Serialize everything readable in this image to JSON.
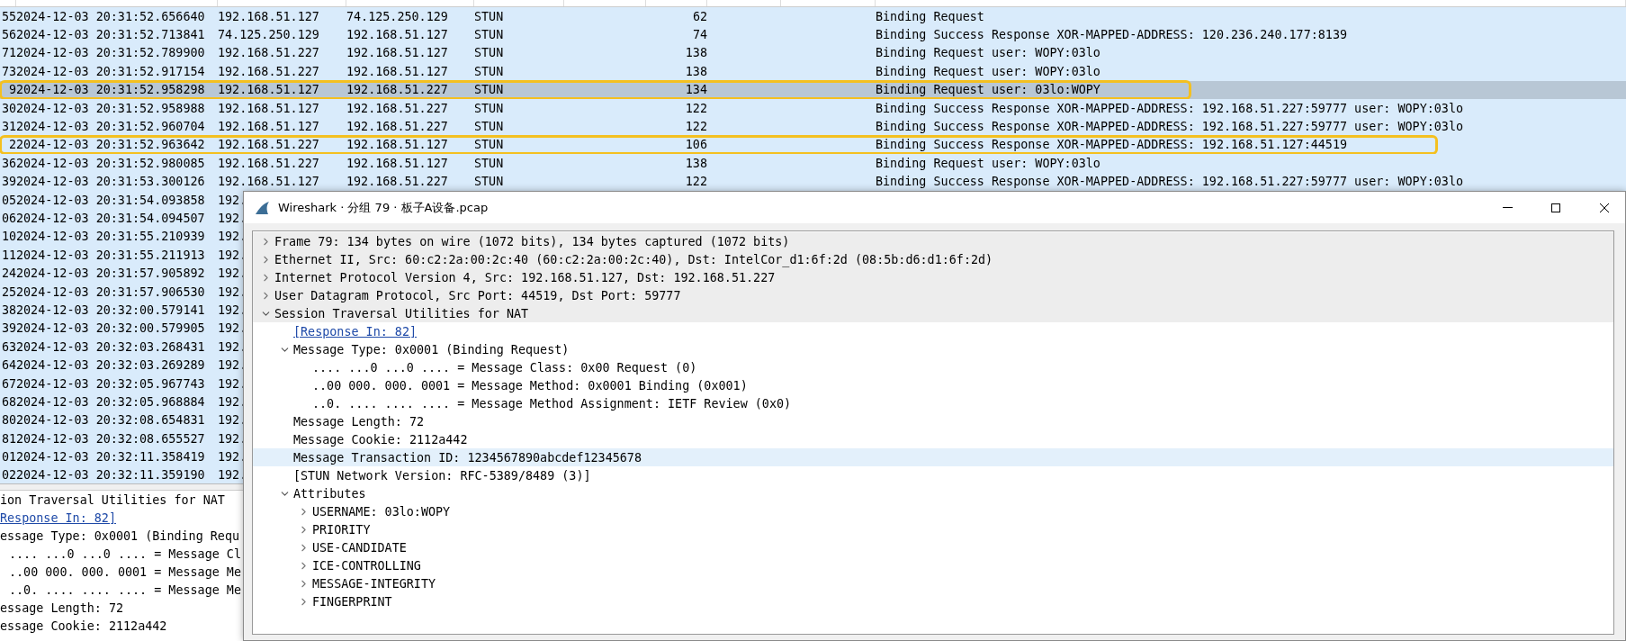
{
  "packet_list": {
    "rows": [
      {
        "no": "55",
        "time": "2024-12-03 20:31:52.656640",
        "source": "192.168.51.127",
        "destination": "74.125.250.129",
        "protocol": "STUN",
        "length": "62",
        "info": "Binding Request",
        "selected": false,
        "annotated": false
      },
      {
        "no": "56",
        "time": "2024-12-03 20:31:52.713841",
        "source": "74.125.250.129",
        "destination": "192.168.51.127",
        "protocol": "STUN",
        "length": "74",
        "info": "Binding Success Response XOR-MAPPED-ADDRESS: 120.236.240.177:8139",
        "selected": false,
        "annotated": false
      },
      {
        "no": "71",
        "time": "2024-12-03 20:31:52.789900",
        "source": "192.168.51.227",
        "destination": "192.168.51.127",
        "protocol": "STUN",
        "length": "138",
        "info": "Binding Request user: WOPY:03lo",
        "selected": false,
        "annotated": false
      },
      {
        "no": "73",
        "time": "2024-12-03 20:31:52.917154",
        "source": "192.168.51.227",
        "destination": "192.168.51.127",
        "protocol": "STUN",
        "length": "138",
        "info": "Binding Request user: WOPY:03lo",
        "selected": false,
        "annotated": false
      },
      {
        "no": "9",
        "time": "2024-12-03 20:31:52.958298",
        "source": "192.168.51.127",
        "destination": "192.168.51.227",
        "protocol": "STUN",
        "length": "134",
        "info": "Binding Request user: 03lo:WOPY",
        "selected": true,
        "annotated": true
      },
      {
        "no": "30",
        "time": "2024-12-03 20:31:52.958988",
        "source": "192.168.51.127",
        "destination": "192.168.51.227",
        "protocol": "STUN",
        "length": "122",
        "info": "Binding Success Response XOR-MAPPED-ADDRESS: 192.168.51.227:59777 user: WOPY:03lo",
        "selected": false,
        "annotated": false
      },
      {
        "no": "31",
        "time": "2024-12-03 20:31:52.960704",
        "source": "192.168.51.127",
        "destination": "192.168.51.227",
        "protocol": "STUN",
        "length": "122",
        "info": "Binding Success Response XOR-MAPPED-ADDRESS: 192.168.51.227:59777 user: WOPY:03lo",
        "selected": false,
        "annotated": false
      },
      {
        "no": "2",
        "time": "2024-12-03 20:31:52.963642",
        "source": "192.168.51.227",
        "destination": "192.168.51.127",
        "protocol": "STUN",
        "length": "106",
        "info": "Binding Success Response XOR-MAPPED-ADDRESS: 192.168.51.127:44519",
        "selected": false,
        "annotated": true
      },
      {
        "no": "36",
        "time": "2024-12-03 20:31:52.980085",
        "source": "192.168.51.227",
        "destination": "192.168.51.127",
        "protocol": "STUN",
        "length": "138",
        "info": "Binding Request user: WOPY:03lo",
        "selected": false,
        "annotated": false
      },
      {
        "no": "39",
        "time": "2024-12-03 20:31:53.300126",
        "source": "192.168.51.127",
        "destination": "192.168.51.227",
        "protocol": "STUN",
        "length": "122",
        "info": "Binding Success Response XOR-MAPPED-ADDRESS: 192.168.51.227:59777 user: WOPY:03lo",
        "selected": false,
        "annotated": false
      },
      {
        "no": "05",
        "time": "2024-12-03 20:31:54.093858",
        "source": "192.",
        "selected": false,
        "annotated": false
      },
      {
        "no": "06",
        "time": "2024-12-03 20:31:54.094507",
        "source": "192.",
        "selected": false,
        "annotated": false
      },
      {
        "no": "10",
        "time": "2024-12-03 20:31:55.210939",
        "source": "192.",
        "selected": false,
        "annotated": false
      },
      {
        "no": "11",
        "time": "2024-12-03 20:31:55.211913",
        "source": "192.",
        "selected": false,
        "annotated": false
      },
      {
        "no": "24",
        "time": "2024-12-03 20:31:57.905892",
        "source": "192.",
        "selected": false,
        "annotated": false
      },
      {
        "no": "25",
        "time": "2024-12-03 20:31:57.906530",
        "source": "192.",
        "selected": false,
        "annotated": false
      },
      {
        "no": "38",
        "time": "2024-12-03 20:32:00.579141",
        "source": "192.",
        "selected": false,
        "annotated": false
      },
      {
        "no": "39",
        "time": "2024-12-03 20:32:00.579905",
        "source": "192.",
        "selected": false,
        "annotated": false
      },
      {
        "no": "63",
        "time": "2024-12-03 20:32:03.268431",
        "source": "192.",
        "selected": false,
        "annotated": false
      },
      {
        "no": "64",
        "time": "2024-12-03 20:32:03.269289",
        "source": "192.",
        "selected": false,
        "annotated": false
      },
      {
        "no": "67",
        "time": "2024-12-03 20:32:05.967743",
        "source": "192.",
        "selected": false,
        "annotated": false
      },
      {
        "no": "68",
        "time": "2024-12-03 20:32:05.968884",
        "source": "192.",
        "selected": false,
        "annotated": false
      },
      {
        "no": "80",
        "time": "2024-12-03 20:32:08.654831",
        "source": "192.",
        "selected": false,
        "annotated": false
      },
      {
        "no": "81",
        "time": "2024-12-03 20:32:08.655527",
        "source": "192.",
        "selected": false,
        "annotated": false
      },
      {
        "no": "01",
        "time": "2024-12-03 20:32:11.358419",
        "source": "192.",
        "selected": false,
        "annotated": false
      },
      {
        "no": "02",
        "time": "2024-12-03 20:32:11.359190",
        "source": "192.",
        "selected": false,
        "annotated": false
      }
    ]
  },
  "detail_pane": [
    {
      "text": "ion Traversal Utilities for NAT",
      "kind": "field",
      "children": [
        {
          "text": "Response In: 82]",
          "kind": "link"
        },
        {
          "text": "essage Type: 0x0001 (Binding Requ",
          "kind": "field",
          "children": [
            {
              "text": ".... ...0 ...0 .... = Message Cl",
              "kind": "field"
            },
            {
              "text": "..00 000. 000. 0001 = Message Me",
              "kind": "field"
            },
            {
              "text": "..0. .... .... .... = Message Me",
              "kind": "field"
            }
          ]
        },
        {
          "text": "essage Length: 72",
          "kind": "field"
        },
        {
          "text": "essage Cookie: 2112a442",
          "kind": "field"
        }
      ]
    }
  ],
  "packet_window": {
    "title": "Wireshark · 分组 79 · 板子A设备.pcap",
    "tree": [
      {
        "text": "Frame 79: 134 bytes on wire (1072 bits), 134 bytes captured (1072 bits)",
        "kind": "field",
        "expanded": false,
        "selected": false
      },
      {
        "text": "Ethernet II, Src: 60:c2:2a:00:2c:40 (60:c2:2a:00:2c:40), Dst: IntelCor_d1:6f:2d (08:5b:d6:d1:6f:2d)",
        "kind": "field",
        "expanded": false,
        "selected": false
      },
      {
        "text": "Internet Protocol Version 4, Src: 192.168.51.127, Dst: 192.168.51.227",
        "kind": "field",
        "expanded": false,
        "selected": false
      },
      {
        "text": "User Datagram Protocol, Src Port: 44519, Dst Port: 59777",
        "kind": "field",
        "expanded": false,
        "selected": false
      },
      {
        "text": "Session Traversal Utilities for NAT",
        "kind": "field",
        "expanded": true,
        "selected": false,
        "children": [
          {
            "text": "[Response In: 82]",
            "kind": "link",
            "selected": false
          },
          {
            "text": "Message Type: 0x0001 (Binding Request)",
            "kind": "field",
            "expanded": true,
            "selected": false,
            "children": [
              {
                "text": ".... ...0 ...0 .... = Message Class: 0x00 Request (0)",
                "kind": "field",
                "selected": false
              },
              {
                "text": "..00 000. 000. 0001 = Message Method: 0x0001 Binding (0x001)",
                "kind": "field",
                "selected": false
              },
              {
                "text": "..0. .... .... .... = Message Method Assignment: IETF Review (0x0)",
                "kind": "field",
                "selected": false
              }
            ]
          },
          {
            "text": "Message Length: 72",
            "kind": "field",
            "selected": false
          },
          {
            "text": "Message Cookie: 2112a442",
            "kind": "field",
            "selected": false
          },
          {
            "text": "Message Transaction ID: 1234567890abcdef12345678",
            "kind": "field",
            "selected": true
          },
          {
            "text": "[STUN Network Version: RFC-5389/8489 (3)]",
            "kind": "field",
            "selected": false
          },
          {
            "text": "Attributes",
            "kind": "field",
            "expanded": true,
            "selected": false,
            "children": [
              {
                "text": "USERNAME: 03lo:WOPY",
                "kind": "field",
                "expanded": false,
                "selected": false
              },
              {
                "text": "PRIORITY",
                "kind": "field",
                "expanded": false,
                "selected": false
              },
              {
                "text": "USE-CANDIDATE",
                "kind": "field",
                "expanded": false,
                "selected": false
              },
              {
                "text": "ICE-CONTROLLING",
                "kind": "field",
                "expanded": false,
                "selected": false
              },
              {
                "text": "MESSAGE-INTEGRITY",
                "kind": "field",
                "expanded": false,
                "selected": false
              },
              {
                "text": "FINGERPRINT",
                "kind": "field",
                "expanded": false,
                "selected": false
              }
            ]
          }
        ]
      }
    ]
  }
}
